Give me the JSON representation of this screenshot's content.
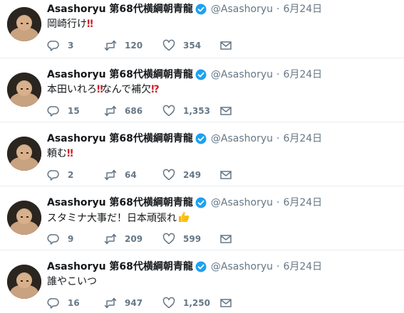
{
  "tweets": [
    {
      "name": "Asashoryu 第68代横綱朝青龍",
      "handle": "@Asashoryu",
      "date": "6月24日",
      "text_parts": [
        "岡崎行け",
        "‼"
      ],
      "replies": "3",
      "retweets": "120",
      "likes": "354"
    },
    {
      "name": "Asashoryu 第68代横綱朝青龍",
      "handle": "@Asashoryu",
      "date": "6月24日",
      "text_parts": [
        "本田いれろ",
        "‼",
        "なんで補欠",
        "⁉"
      ],
      "replies": "15",
      "retweets": "686",
      "likes": "1,353"
    },
    {
      "name": "Asashoryu 第68代横綱朝青龍",
      "handle": "@Asashoryu",
      "date": "6月24日",
      "text_parts": [
        "頼む",
        "‼"
      ],
      "replies": "2",
      "retweets": "64",
      "likes": "249"
    },
    {
      "name": "Asashoryu 第68代横綱朝青龍",
      "handle": "@Asashoryu",
      "date": "6月24日",
      "text_parts": [
        "スタミナ大事だ！日本頑張れ"
      ],
      "emoji": "thumbs-up",
      "replies": "9",
      "retweets": "209",
      "likes": "599"
    },
    {
      "name": "Asashoryu 第68代横綱朝青龍",
      "handle": "@Asashoryu",
      "date": "6月24日",
      "text_parts": [
        "誰やこいつ"
      ],
      "replies": "16",
      "retweets": "947",
      "likes": "1,250"
    }
  ],
  "colors": {
    "verified": "#1da1f2",
    "muted": "#657786",
    "text": "#14171a",
    "emoji_red": "#cc1f2e",
    "divider": "#e6ecf0"
  },
  "icons": {
    "reply": "reply-icon",
    "retweet": "retweet-icon",
    "like": "heart-icon",
    "dm": "envelope-icon",
    "verified": "verified-badge-icon"
  }
}
